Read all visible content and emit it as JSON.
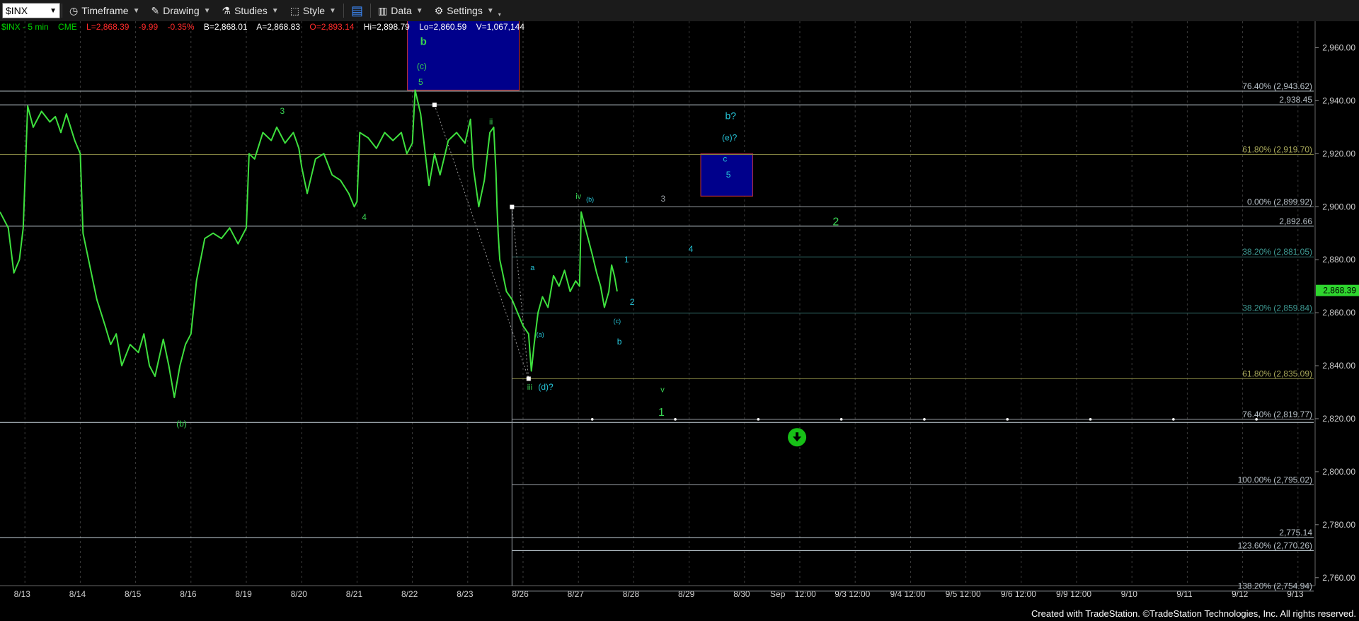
{
  "toolbar": {
    "symbol": "$INX",
    "timeframe": "Timeframe",
    "drawing": "Drawing",
    "studies": "Studies",
    "style": "Style",
    "data": "Data",
    "settings": "Settings"
  },
  "info": {
    "symbol": "$INX - 5 min",
    "exchange": "CME",
    "last": "L=2,868.39",
    "change": "-9.99",
    "change_pct": "-0.35%",
    "bid": "B=2,868.01",
    "ask": "A=2,868.83",
    "open": "O=2,893.14",
    "high": "Hi=2,898.79",
    "low": "Lo=2,860.59",
    "volume": "V=1,067,144"
  },
  "footer": "Created with TradeStation. ©TradeStation Technologies, Inc. All rights reserved.",
  "chart_data": {
    "type": "line",
    "title": "",
    "ylim": [
      2757,
      2970
    ],
    "y_ticks": [
      2760,
      2780,
      2800,
      2820,
      2840,
      2860,
      2880,
      2900,
      2920,
      2940,
      2960
    ],
    "y_tick_labels": [
      "2,760.00",
      "2,780.00",
      "2,800.00",
      "2,820.00",
      "2,840.00",
      "2,860.00",
      "2,880.00",
      "2,900.00",
      "2,920.00",
      "2,940.00",
      "2,960.00"
    ],
    "last_price": 2868.39,
    "last_price_label": "2,868.39",
    "x_labels": [
      "8/13",
      "8/14",
      "8/15",
      "8/16",
      "8/19",
      "8/20",
      "8/21",
      "8/22",
      "8/23",
      "8/26",
      "8/27",
      "8/28",
      "8/29",
      "8/30",
      "Sep",
      "12:00",
      "9/3 12:00",
      "9/4 12:00",
      "9/5 12:00",
      "9/6 12:00",
      "9/9 12:00",
      "9/10",
      "9/11",
      "9/12",
      "9/13"
    ],
    "x_label_slot": [
      0.4,
      1.4,
      2.4,
      3.4,
      4.4,
      5.4,
      6.4,
      7.4,
      8.4,
      9.4,
      10.4,
      11.4,
      12.4,
      13.4,
      14.05,
      14.55,
      15.4,
      16.4,
      17.4,
      18.4,
      19.4,
      20.4,
      21.4,
      22.4,
      23.4
    ],
    "day_separators": [
      0.45,
      1.45,
      2.45,
      3.45,
      4.45,
      5.45,
      6.45,
      7.45,
      8.45,
      9.45,
      10.45,
      11.45,
      12.45,
      13.45,
      14.45,
      15.45,
      16.45,
      17.45,
      18.45,
      19.45,
      20.45,
      21.45,
      22.45,
      23.45
    ],
    "price_series": [
      [
        0.0,
        2898
      ],
      [
        0.15,
        2892
      ],
      [
        0.25,
        2875
      ],
      [
        0.35,
        2880
      ],
      [
        0.42,
        2892
      ],
      [
        0.5,
        2938
      ],
      [
        0.6,
        2930
      ],
      [
        0.75,
        2936
      ],
      [
        0.9,
        2932
      ],
      [
        1.0,
        2934
      ],
      [
        1.1,
        2928
      ],
      [
        1.2,
        2935
      ],
      [
        1.35,
        2925
      ],
      [
        1.45,
        2920
      ],
      [
        1.5,
        2890
      ],
      [
        1.6,
        2880
      ],
      [
        1.75,
        2865
      ],
      [
        1.9,
        2855
      ],
      [
        2.0,
        2848
      ],
      [
        2.1,
        2852
      ],
      [
        2.2,
        2840
      ],
      [
        2.35,
        2848
      ],
      [
        2.5,
        2845
      ],
      [
        2.6,
        2852
      ],
      [
        2.7,
        2840
      ],
      [
        2.8,
        2836
      ],
      [
        2.95,
        2850
      ],
      [
        3.05,
        2840
      ],
      [
        3.15,
        2828
      ],
      [
        3.25,
        2840
      ],
      [
        3.35,
        2848
      ],
      [
        3.45,
        2852
      ],
      [
        3.55,
        2872
      ],
      [
        3.7,
        2888
      ],
      [
        3.85,
        2890
      ],
      [
        4.0,
        2888
      ],
      [
        4.15,
        2892
      ],
      [
        4.3,
        2886
      ],
      [
        4.4,
        2890
      ],
      [
        4.45,
        2892
      ],
      [
        4.5,
        2920
      ],
      [
        4.6,
        2918
      ],
      [
        4.75,
        2928
      ],
      [
        4.9,
        2925
      ],
      [
        5.0,
        2930
      ],
      [
        5.15,
        2924
      ],
      [
        5.3,
        2928
      ],
      [
        5.4,
        2922
      ],
      [
        5.45,
        2915
      ],
      [
        5.55,
        2905
      ],
      [
        5.7,
        2918
      ],
      [
        5.85,
        2920
      ],
      [
        6.0,
        2912
      ],
      [
        6.15,
        2910
      ],
      [
        6.3,
        2905
      ],
      [
        6.4,
        2900
      ],
      [
        6.45,
        2902
      ],
      [
        6.5,
        2928
      ],
      [
        6.65,
        2926
      ],
      [
        6.8,
        2922
      ],
      [
        6.95,
        2928
      ],
      [
        7.1,
        2925
      ],
      [
        7.25,
        2928
      ],
      [
        7.35,
        2920
      ],
      [
        7.45,
        2924
      ],
      [
        7.5,
        2944
      ],
      [
        7.6,
        2935
      ],
      [
        7.75,
        2908
      ],
      [
        7.85,
        2920
      ],
      [
        7.95,
        2912
      ],
      [
        8.1,
        2925
      ],
      [
        8.25,
        2928
      ],
      [
        8.4,
        2924
      ],
      [
        8.5,
        2933
      ],
      [
        8.55,
        2915
      ],
      [
        8.65,
        2900
      ],
      [
        8.75,
        2910
      ],
      [
        8.85,
        2928
      ],
      [
        8.92,
        2930
      ],
      [
        8.96,
        2913
      ],
      [
        8.98,
        2900
      ],
      [
        9.0,
        2890
      ],
      [
        9.03,
        2880
      ],
      [
        9.08,
        2875
      ],
      [
        9.15,
        2868
      ],
      [
        9.25,
        2865
      ],
      [
        9.35,
        2860
      ],
      [
        9.45,
        2855
      ],
      [
        9.55,
        2852
      ],
      [
        9.6,
        2838
      ],
      [
        9.65,
        2848
      ],
      [
        9.72,
        2860
      ],
      [
        9.8,
        2866
      ],
      [
        9.9,
        2862
      ],
      [
        10.0,
        2874
      ],
      [
        10.1,
        2870
      ],
      [
        10.2,
        2876
      ],
      [
        10.3,
        2868
      ],
      [
        10.4,
        2872
      ],
      [
        10.47,
        2870
      ],
      [
        10.5,
        2898
      ],
      [
        10.6,
        2890
      ],
      [
        10.7,
        2882
      ],
      [
        10.78,
        2875
      ],
      [
        10.85,
        2870
      ],
      [
        10.92,
        2862
      ],
      [
        11.0,
        2868
      ],
      [
        11.05,
        2878
      ],
      [
        11.1,
        2874
      ],
      [
        11.15,
        2868
      ]
    ],
    "horizontal_lines": [
      {
        "y": 2943.62,
        "label": "76.40% (2,943.62)",
        "color": "#c8d4dc"
      },
      {
        "y": 2938.45,
        "label": "2,938.45",
        "color": "#c8d4dc"
      },
      {
        "y": 2919.7,
        "label": "61.80% (2,919.70)",
        "color": "#808040"
      },
      {
        "y": 2899.92,
        "label": "0.00% (2,899.92)",
        "color": "#9aa0a6"
      },
      {
        "y": 2892.66,
        "label": "2,892.66",
        "color": "#c8d4dc"
      },
      {
        "y": 2881.05,
        "label": "38.20% (2,881.05)",
        "color": "#2f6b66"
      },
      {
        "y": 2859.84,
        "label": "38.20% (2,859.84)",
        "color": "#2f6b66"
      },
      {
        "y": 2835.09,
        "label": "61.80% (2,835.09)",
        "color": "#808040"
      },
      {
        "y": 2819.77,
        "label": "76.40% (2,819.77)",
        "color": "#9aa0a6"
      },
      {
        "y": 2818.6,
        "label": "",
        "color": "#c8d4dc"
      },
      {
        "y": 2795.02,
        "label": "100.00% (2,795.02)",
        "color": "#9aa0a6"
      },
      {
        "y": 2775.14,
        "label": "2,775.14",
        "color": "#c8d4dc"
      },
      {
        "y": 2770.26,
        "label": "123.60% (2,770.26)",
        "color": "#c8d4dc"
      },
      {
        "y": 2754.94,
        "label": "138.20% (2,754.94)",
        "color": "#9aa0a6"
      }
    ],
    "annotations": [
      {
        "t": "b",
        "x": 7.65,
        "y": 2961,
        "c": "#39d353",
        "s": 15,
        "b": true
      },
      {
        "t": "(c)",
        "x": 7.62,
        "y": 2952,
        "c": "#39d353",
        "s": 12
      },
      {
        "t": "5",
        "x": 7.6,
        "y": 2946,
        "c": "#39d353",
        "s": 12
      },
      {
        "t": "3",
        "x": 5.1,
        "y": 2935,
        "c": "#39d353",
        "s": 12
      },
      {
        "t": "4",
        "x": 6.58,
        "y": 2895,
        "c": "#39d353",
        "s": 12
      },
      {
        "t": "(b)",
        "x": 3.28,
        "y": 2817,
        "c": "#39d353",
        "s": 12
      },
      {
        "t": "ii",
        "x": 8.87,
        "y": 2931,
        "c": "#39d353",
        "s": 12
      },
      {
        "t": "iv",
        "x": 10.45,
        "y": 2903,
        "c": "#39d353",
        "s": 11
      },
      {
        "t": "(b)",
        "x": 10.66,
        "y": 2902,
        "c": "#26c6da",
        "s": 9
      },
      {
        "t": "3",
        "x": 11.98,
        "y": 2902,
        "c": "#9aa0a6",
        "s": 12
      },
      {
        "t": "4",
        "x": 12.48,
        "y": 2883,
        "c": "#26c6da",
        "s": 12
      },
      {
        "t": "a",
        "x": 9.62,
        "y": 2876,
        "c": "#26c6da",
        "s": 11
      },
      {
        "t": "(a)",
        "x": 9.76,
        "y": 2851,
        "c": "#26c6da",
        "s": 9
      },
      {
        "t": "1",
        "x": 11.32,
        "y": 2879,
        "c": "#26c6da",
        "s": 12
      },
      {
        "t": "2",
        "x": 11.42,
        "y": 2863,
        "c": "#26c6da",
        "s": 12
      },
      {
        "t": "(c)",
        "x": 11.15,
        "y": 2856,
        "c": "#26c6da",
        "s": 9
      },
      {
        "t": "b",
        "x": 11.19,
        "y": 2848,
        "c": "#26c6da",
        "s": 12
      },
      {
        "t": "iii",
        "x": 9.57,
        "y": 2831,
        "c": "#39d353",
        "s": 11
      },
      {
        "t": "(d)?",
        "x": 9.86,
        "y": 2831,
        "c": "#26c6da",
        "s": 12
      },
      {
        "t": "v",
        "x": 11.97,
        "y": 2830,
        "c": "#39d353",
        "s": 11
      },
      {
        "t": "1",
        "x": 11.95,
        "y": 2821,
        "c": "#39d353",
        "s": 16
      },
      {
        "t": "2",
        "x": 15.1,
        "y": 2893,
        "c": "#39d353",
        "s": 16
      },
      {
        "t": "b?",
        "x": 13.2,
        "y": 2933,
        "c": "#26c6da",
        "s": 14
      },
      {
        "t": "(e)?",
        "x": 13.18,
        "y": 2925,
        "c": "#26c6da",
        "s": 12
      },
      {
        "t": "c",
        "x": 13.1,
        "y": 2917,
        "c": "#26c6da",
        "s": 12
      },
      {
        "t": "5",
        "x": 13.16,
        "y": 2911,
        "c": "#26c6da",
        "s": 12
      }
    ],
    "boxes": [
      {
        "x1": 7.36,
        "x2": 9.38,
        "y1": 2944,
        "y2": 2973,
        "fill": "#00008b",
        "stroke": "#c0303a"
      },
      {
        "x1": 12.66,
        "x2": 13.6,
        "y1": 2904,
        "y2": 2920,
        "fill": "#00008b",
        "stroke": "#c0303a"
      }
    ],
    "down_arrow_marker": {
      "x": 14.4,
      "y": 2813
    }
  }
}
